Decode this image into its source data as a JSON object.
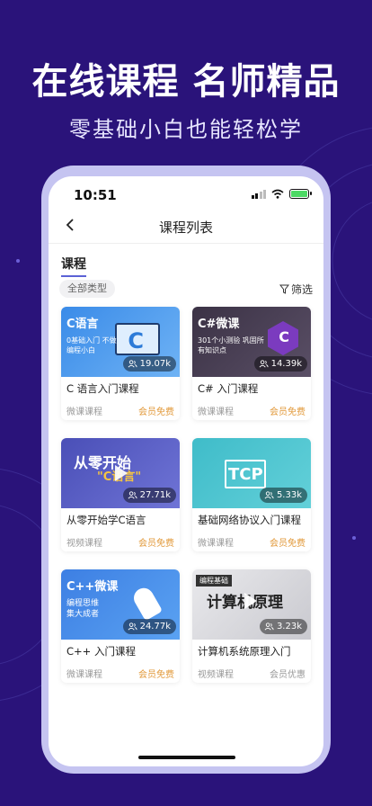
{
  "promo": {
    "headline": "在线课程 名师精品",
    "subline": "零基础小白也能轻松学"
  },
  "status_bar": {
    "time": "10:51"
  },
  "nav": {
    "title": "课程列表"
  },
  "section": {
    "title": "课程"
  },
  "filter": {
    "type_chip": "全部类型",
    "filter_label": "筛选"
  },
  "courses": [
    {
      "thumb_title": "C语言",
      "thumb_desc": "0基础入门 不做编程小白",
      "views": "19.07k",
      "title": "C 语言入门课程",
      "type": "微课课程",
      "price": "会员免费"
    },
    {
      "thumb_title": "C#微课",
      "thumb_desc": "301个小测验 巩固所有知识点",
      "views": "14.39k",
      "title": "C# 入门课程",
      "type": "微课课程",
      "price": "会员免费"
    },
    {
      "thumb_title": "从零开始",
      "thumb_desc": "\"C语言\"",
      "views": "27.71k",
      "title": "从零开始学C语言",
      "type": "视频课程",
      "price": "会员免费"
    },
    {
      "thumb_title": "TCP",
      "thumb_desc": "",
      "views": "5.33k",
      "title": "基础网络协议入门课程",
      "type": "微课课程",
      "price": "会员免费"
    },
    {
      "thumb_title": "C++微课",
      "thumb_desc": "编程思维 集大成者",
      "views": "24.77k",
      "title": "C++ 入门课程",
      "type": "微课课程",
      "price": "会员免费"
    },
    {
      "thumb_title": "计算机原理",
      "thumb_desc": "编程基础",
      "views": "3.23k",
      "title": "计算机系统原理入门",
      "type": "视频课程",
      "price": "会员优惠"
    }
  ],
  "colors": {
    "background": "#2a137a",
    "accent_price": "#e2993a",
    "section_underline": "#5b62d6"
  }
}
